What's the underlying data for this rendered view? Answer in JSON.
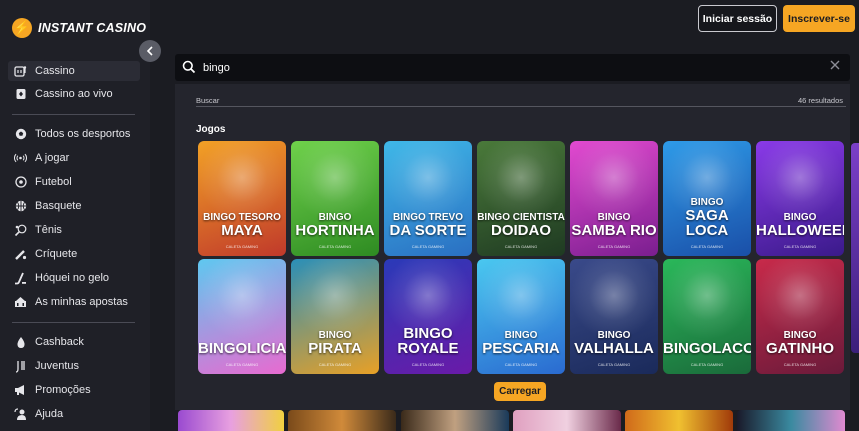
{
  "brand": {
    "name": "INSTANT CASINO",
    "mark": "⚡",
    "accent": "#f6a623"
  },
  "sidebar": {
    "collapse_icon": "chevron-left-icon",
    "items": [
      {
        "label": "Cassino",
        "icon": "slot-machine-icon",
        "active": true
      },
      {
        "label": "Cassino ao vivo",
        "icon": "live-cards-icon"
      },
      {
        "label": "Todos os desportos",
        "icon": "soccer-ball-icon"
      },
      {
        "label": "A jogar",
        "icon": "live-signal-icon"
      },
      {
        "label": "Futebol",
        "icon": "football-icon"
      },
      {
        "label": "Basquete",
        "icon": "basketball-icon"
      },
      {
        "label": "Tênis",
        "icon": "tennis-icon"
      },
      {
        "label": "Críquete",
        "icon": "cricket-icon"
      },
      {
        "label": "Hóquei no gelo",
        "icon": "hockey-icon"
      },
      {
        "label": "As minhas apostas",
        "icon": "bets-icon"
      },
      {
        "label": "Cashback",
        "icon": "cashback-icon"
      },
      {
        "label": "Juventus",
        "icon": "juventus-icon"
      },
      {
        "label": "Promoções",
        "icon": "megaphone-icon"
      },
      {
        "label": "Ajuda",
        "icon": "help-icon"
      }
    ]
  },
  "header": {
    "login_label": "Iniciar sessão",
    "register_label": "Inscrever-se"
  },
  "search": {
    "value": "bingo",
    "results_label": "Buscar",
    "results_count": "46 resultados"
  },
  "games_section": {
    "title": "Jogos",
    "tiles": [
      {
        "line1": "BINGO TESORO",
        "line2": "MAYA",
        "provider": "CALETA GAMING",
        "colors": [
          "#f2a126",
          "#c0392b"
        ]
      },
      {
        "line1": "BINGO",
        "line2": "HORTINHA",
        "provider": "CALETA GAMING",
        "colors": [
          "#6fd14b",
          "#2e8b22"
        ]
      },
      {
        "line1": "BINGO TREVO",
        "line2": "DA SORTE",
        "provider": "CALETA GAMING",
        "colors": [
          "#3fb8e8",
          "#2a6fc2"
        ]
      },
      {
        "line1": "BINGO CIENTISTA",
        "line2": "DOIDAO",
        "provider": "CALETA GAMING",
        "colors": [
          "#4a7a3a",
          "#1f3a22"
        ]
      },
      {
        "line1": "BINGO",
        "line2": "SAMBA RIO",
        "provider": "CALETA GAMING",
        "colors": [
          "#e24ad0",
          "#7a1e8f"
        ]
      },
      {
        "line1": "BINGO",
        "line2": "SAGA LOCA",
        "provider": "CALETA GAMING",
        "colors": [
          "#2e9be8",
          "#1a4fa8"
        ]
      },
      {
        "line1": "BINGO",
        "line2": "HALLOWEEN",
        "provider": "CALETA GAMING",
        "colors": [
          "#8a3ae8",
          "#3a1a8a"
        ]
      },
      {
        "line1": "",
        "line2": "BINGOLICIA",
        "provider": "CALETA GAMING",
        "colors": [
          "#5ec8f0",
          "#e86ad0"
        ]
      },
      {
        "line1": "BINGO",
        "line2": "PIRATA",
        "provider": "CALETA GAMING",
        "colors": [
          "#2a8fb8",
          "#e8a026"
        ]
      },
      {
        "line1": "",
        "line2": "BINGO ROYALE",
        "provider": "CALETA GAMING",
        "colors": [
          "#2a3ab8",
          "#6a1aa8"
        ]
      },
      {
        "line1": "BINGO",
        "line2": "PESCARIA",
        "provider": "CALETA GAMING",
        "colors": [
          "#4ac8f0",
          "#2a6ad0"
        ]
      },
      {
        "line1": "BINGO",
        "line2": "VALHALLA",
        "provider": "CALETA GAMING",
        "colors": [
          "#3a4a8a",
          "#1a2a5a"
        ]
      },
      {
        "line1": "",
        "line2": "BINGOLACO",
        "provider": "CALETA GAMING",
        "colors": [
          "#2ab85a",
          "#1a6a3a"
        ]
      },
      {
        "line1": "BINGO",
        "line2": "GATINHO",
        "provider": "CALETA GAMING",
        "colors": [
          "#c82a4a",
          "#6a1a3a"
        ]
      }
    ],
    "load_more_label": "Carregar"
  }
}
